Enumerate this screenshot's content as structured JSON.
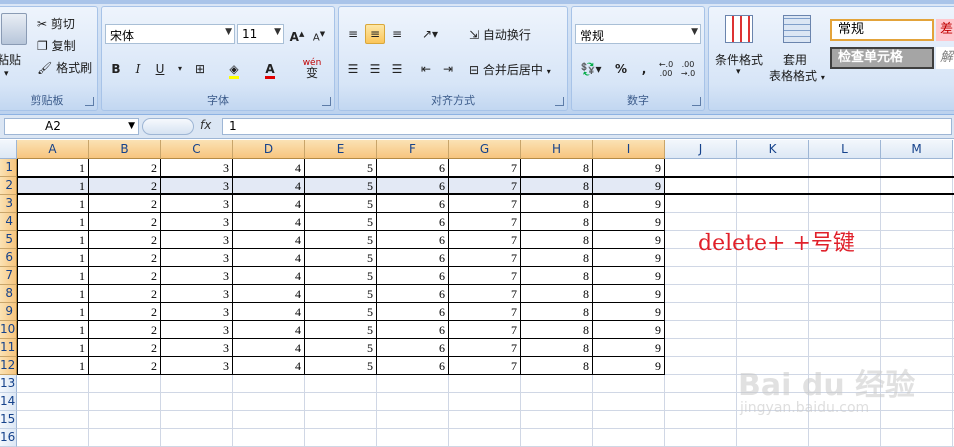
{
  "clipboard": {
    "paste": "粘贴",
    "cut": "剪切",
    "copy": "复制",
    "format_painter": "格式刷",
    "group": "剪贴板"
  },
  "font": {
    "name": "宋体",
    "size": "11",
    "bold": "B",
    "italic": "I",
    "underline": "U",
    "grow": "A",
    "shrink": "A",
    "color_a": "A",
    "wen": "wén",
    "phonetic": "变",
    "group": "字体"
  },
  "alignment": {
    "wrap": "自动换行",
    "merge": "合并后居中",
    "group": "对齐方式"
  },
  "number": {
    "format": "常规",
    "percent": "%",
    "comma": ",",
    "inc": "←.0 .00",
    "dec": ".00 →.0",
    "group": "数字"
  },
  "styles": {
    "conditional": "条件格式",
    "table": "套用",
    "table2": "表格格式",
    "style_normal": "常规",
    "style_check": "检查单元格",
    "style_bad": "差",
    "style_other": "解"
  },
  "formula": {
    "name_box": "A2",
    "fx": "fx",
    "value": "1"
  },
  "sheet": {
    "columns": [
      "A",
      "B",
      "C",
      "D",
      "E",
      "F",
      "G",
      "H",
      "I",
      "J",
      "K",
      "L",
      "M"
    ],
    "row_labels": [
      "1",
      "2",
      "3",
      "4",
      "5",
      "6",
      "7",
      "8",
      "9",
      "10",
      "11",
      "12",
      "13",
      "14",
      "15",
      "16"
    ],
    "data_row": [
      "1",
      "2",
      "3",
      "4",
      "5",
      "6",
      "7",
      "8",
      "9"
    ],
    "data_rows": 12,
    "selected_row": 2
  },
  "annotation": "delete+  +号键",
  "watermark": {
    "main": "Bai du 经验",
    "sub": "jingyan.baidu.com"
  },
  "colors": {
    "ribbon": "#c6d9f1",
    "header_active": "#f7c57e",
    "annotation": "#e0202a"
  }
}
